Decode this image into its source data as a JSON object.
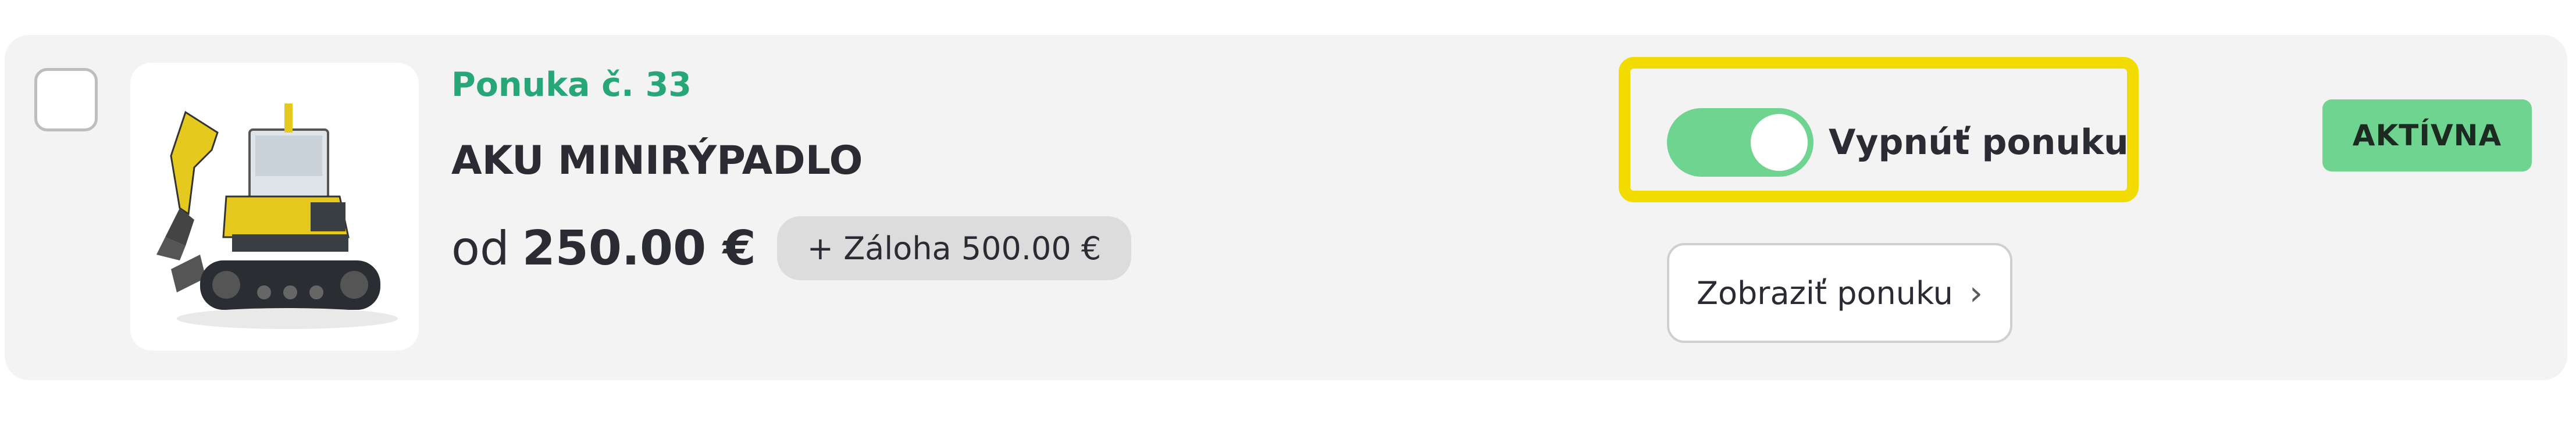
{
  "offer": {
    "number_label": "Ponuka č. 33",
    "title": "AKU MINIRÝPADLO",
    "price_prefix": "od",
    "price": "250.00 €",
    "deposit": "+ Záloha 500.00 €",
    "toggle_label": "Vypnúť ponuku",
    "toggle_on": true,
    "view_button_label": "Zobraziť ponuku",
    "status": "AKTÍVNA"
  },
  "icons": {
    "product_image": "excavator-image",
    "view_chevron": "chevron-right-icon"
  },
  "colors": {
    "accent_green": "#27a778",
    "toggle_green": "#6fd48f",
    "highlight_yellow": "#f2dc00",
    "card_bg": "#f3f3f3"
  }
}
